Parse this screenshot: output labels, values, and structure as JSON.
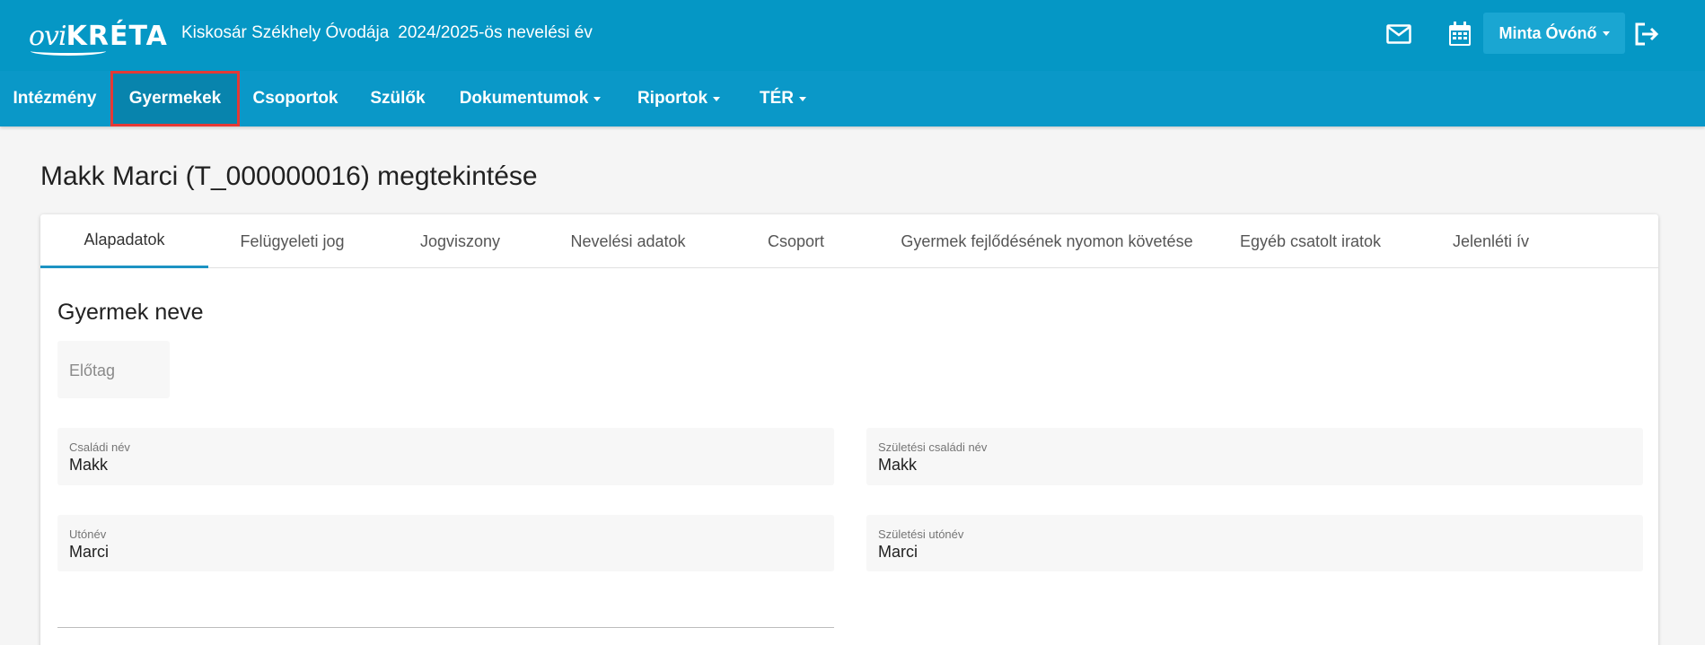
{
  "header": {
    "logo_ovi": "ovi",
    "logo_kreta": "KRÉTA",
    "institution": "Kiskosár Székhely Óvodája",
    "school_year": "2024/2025-ös nevelési év",
    "mail_icon": "mail-icon",
    "calendar_icon": "calendar-icon",
    "user_name": "Minta Óvónő",
    "logout_icon": "logout-icon"
  },
  "nav": {
    "items": [
      {
        "label": "Intézmény",
        "dropdown": false
      },
      {
        "label": "Gyermekek",
        "dropdown": false,
        "active": true
      },
      {
        "label": "Csoportok",
        "dropdown": false
      },
      {
        "label": "Szülők",
        "dropdown": false
      },
      {
        "label": "Dokumentumok",
        "dropdown": true
      },
      {
        "label": "Riportok",
        "dropdown": true
      },
      {
        "label": "TÉR",
        "dropdown": true
      }
    ]
  },
  "page": {
    "title": "Makk Marci (T_000000016) megtekintése"
  },
  "tabs": [
    {
      "label": "Alapadatok",
      "active": true
    },
    {
      "label": "Felügyeleti jog"
    },
    {
      "label": "Jogviszony"
    },
    {
      "label": "Nevelési adatok"
    },
    {
      "label": "Csoport"
    },
    {
      "label": "Gyermek fejlődésének nyomon követése"
    },
    {
      "label": "Egyéb csatolt iratok"
    },
    {
      "label": "Jelenléti ív"
    }
  ],
  "form": {
    "section_title": "Gyermek neve",
    "prefix": {
      "placeholder": "Előtag"
    },
    "family_name": {
      "label": "Családi név",
      "value": "Makk"
    },
    "birth_family_name": {
      "label": "Születési családi név",
      "value": "Makk"
    },
    "given_name": {
      "label": "Utónév",
      "value": "Marci"
    },
    "birth_given_name": {
      "label": "Születési utónév",
      "value": "Marci"
    }
  },
  "colors": {
    "header_bg": "#0597c5",
    "nav_bg": "#0a98c8",
    "active_nav_outline": "#e53935",
    "tab_indicator": "#1c93c3"
  }
}
